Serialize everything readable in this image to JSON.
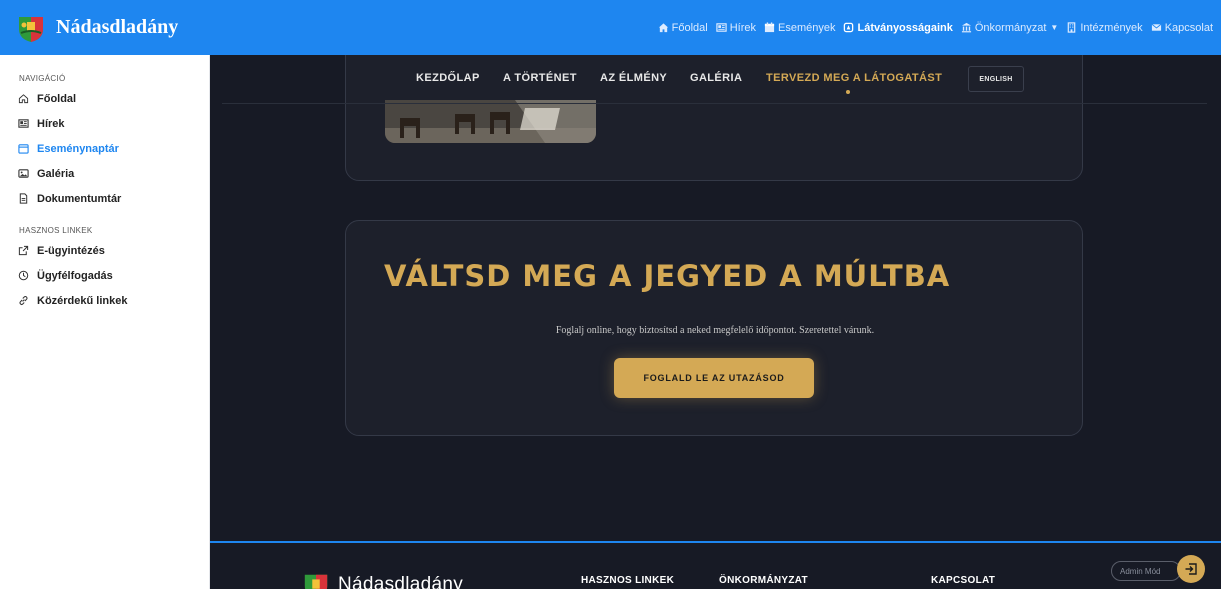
{
  "brand": {
    "name": "Nádasdladány",
    "icon": "crest-icon"
  },
  "topnav": [
    {
      "label": "Főoldal",
      "icon": "home-icon"
    },
    {
      "label": "Hírek",
      "icon": "news-icon"
    },
    {
      "label": "Események",
      "icon": "calendar-icon"
    },
    {
      "label": "Látványosságaink",
      "icon": "landmark-icon",
      "active": true
    },
    {
      "label": "Önkormányzat",
      "icon": "bank-icon",
      "dropdown": true
    },
    {
      "label": "Intézmények",
      "icon": "building-icon"
    },
    {
      "label": "Kapcsolat",
      "icon": "mail-icon"
    }
  ],
  "sidebar": {
    "nav_title": "NAVIGÁCIÓ",
    "nav_items": [
      {
        "label": "Főoldal",
        "icon": "home-icon"
      },
      {
        "label": "Hírek",
        "icon": "news-icon"
      },
      {
        "label": "Eseménynaptár",
        "icon": "calendar-icon",
        "active": true
      },
      {
        "label": "Galéria",
        "icon": "image-icon"
      },
      {
        "label": "Dokumentumtár",
        "icon": "document-icon"
      }
    ],
    "links_title": "HASZNOS LINKEK",
    "link_items": [
      {
        "label": "E-ügyintézés",
        "icon": "external-link-icon"
      },
      {
        "label": "Ügyfélfogadás",
        "icon": "clock-icon"
      },
      {
        "label": "Közérdekű linkek",
        "icon": "link-icon"
      }
    ]
  },
  "subnav": {
    "items": [
      "KEZDŐLAP",
      "A TÖRTÉNET",
      "AZ ÉLMÉNY",
      "GALÉRIA",
      "TERVEZD MEG A LÁTOGATÁST"
    ],
    "active_index": 4,
    "lang_button": "ENGLISH"
  },
  "cta": {
    "title": "VÁLTSD MEG A JEGYED A MÚLTBA",
    "subtitle": "Foglalj online, hogy biztosítsd a neked megfelelő időpontot. Szeretettel várunk.",
    "button": "FOGLALD LE AZ UTAZÁSOD"
  },
  "footer": {
    "brand": "Nádasdladány",
    "headings": [
      "HASZNOS LINKEK",
      "ÖNKORMÁNYZAT",
      "KAPCSOLAT"
    ]
  },
  "admin": {
    "label": "Admin Mód"
  },
  "colors": {
    "primary": "#1e86f0",
    "gold": "#d4a955",
    "dark_bg": "#171a25",
    "card_bg": "#1d202b"
  }
}
